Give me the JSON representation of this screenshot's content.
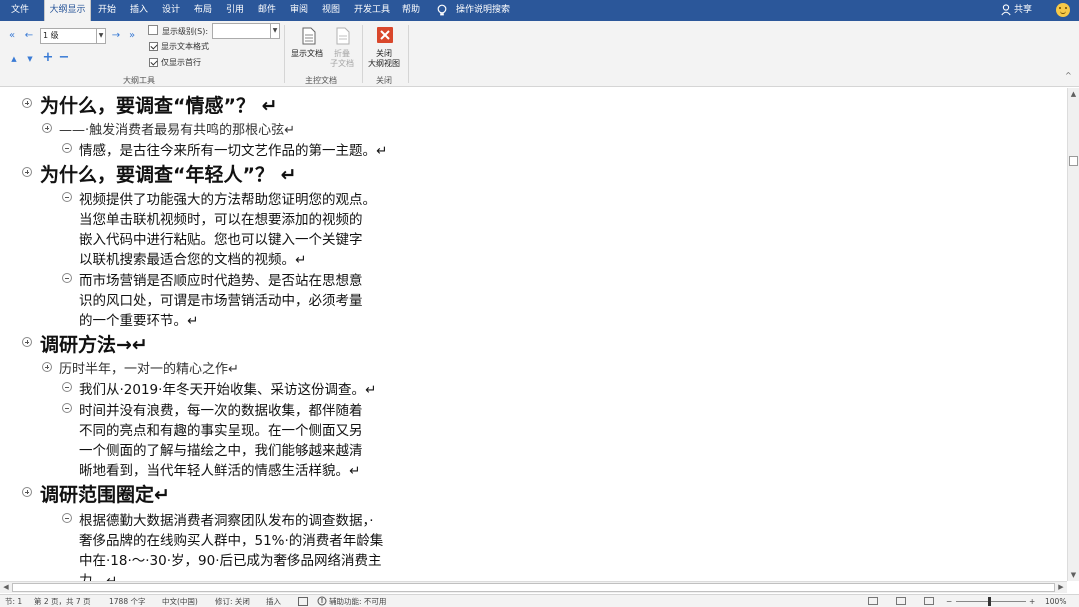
{
  "ribbon_tabs": {
    "file": "文件",
    "outline": "大纲显示",
    "home": "开始",
    "insert": "插入",
    "design": "设计",
    "layout": "布局",
    "references": "引用",
    "mailings": "邮件",
    "review": "审阅",
    "view": "视图",
    "developer": "开发工具",
    "help": "帮助",
    "tell_me": "操作说明搜索",
    "share": "共享"
  },
  "outline_tools": {
    "level_value": "1 级",
    "show_level_label": "显示级别(S):",
    "show_level_value": "",
    "show_text_formatting": "显示文本格式",
    "show_text_formatting_checked": true,
    "show_first_line_only": "仅显示首行",
    "show_first_line_only_checked": true,
    "group_label": "大纲工具"
  },
  "master_document": {
    "show_document": "显示文档",
    "collapse_line1": "折叠",
    "collapse_line2": "子文档",
    "group_label": "主控文档"
  },
  "close_group": {
    "close_line1": "关闭",
    "close_line2": "大纲视图",
    "group_label": "关闭"
  },
  "document": {
    "lines": [
      {
        "kind": "h1",
        "text": "为什么，要调查“情感”？ ↵"
      },
      {
        "kind": "sub",
        "text": "——·触发消费者最易有共鸣的那根心弦↵"
      },
      {
        "kind": "body",
        "text": "情感，是古往今来所有一切文艺作品的第一主题。↵"
      },
      {
        "kind": "h1",
        "text": "为什么，要调查“年轻人”？ ↵"
      },
      {
        "kind": "body",
        "text": "视频提供了功能强大的方法帮助您证明您的观点。"
      },
      {
        "kind": "body",
        "text": "当您单击联机视频时，可以在想要添加的视频的"
      },
      {
        "kind": "body",
        "text": "嵌入代码中进行粘贴。您也可以键入一个关键字"
      },
      {
        "kind": "body",
        "text": "以联机搜索最适合您的文档的视频。↵"
      },
      {
        "kind": "body",
        "text": "而市场营销是否顺应时代趋势、是否站在思想意"
      },
      {
        "kind": "body",
        "text": "识的风口处，可谓是市场营销活动中，必须考量"
      },
      {
        "kind": "body",
        "text": "的一个重要环节。↵"
      },
      {
        "kind": "h1",
        "text": "调研方法→↵"
      },
      {
        "kind": "sub",
        "text": "历时半年，一对一的精心之作↵"
      },
      {
        "kind": "body",
        "text": "我们从·2019·年冬天开始收集、采访这份调查。↵"
      },
      {
        "kind": "body",
        "text": "时间并没有浪费，每一次的数据收集，都伴随着"
      },
      {
        "kind": "body",
        "text": "不同的亮点和有趣的事实呈现。在一个侧面又另"
      },
      {
        "kind": "body",
        "text": "一个侧面的了解与描绘之中，我们能够越来越清"
      },
      {
        "kind": "body",
        "text": "晰地看到，当代年轻人鲜活的情感生活样貌。↵"
      },
      {
        "kind": "h1",
        "text": "调研范围圈定↵"
      },
      {
        "kind": "body",
        "text": "根据德勤大数据消费者洞察团队发布的调查数据，·"
      },
      {
        "kind": "body",
        "text": "奢侈品牌的在线购买人群中，51%·的消费者年龄集"
      },
      {
        "kind": "body",
        "text": "中在·18·～·30·岁，90·后已成为奢侈品网络消费主"
      },
      {
        "kind": "body",
        "text": "力。↵"
      }
    ]
  },
  "status_bar": {
    "section": "节: 1",
    "page": "第 2 页，共 7 页",
    "words": "1788 个字",
    "language": "中文(中国)",
    "track_changes": "修订: 关闭",
    "insert_mode": "插入",
    "accessibility": "辅助功能: 不可用",
    "zoom_minus": "−",
    "zoom_plus": "+",
    "zoom": "100%"
  },
  "colors": {
    "ribbon_blue": "#2b579a",
    "ribbon_bg": "#f3f3f3",
    "close_red": "#d9472b",
    "nav_arrow_blue": "#3a7bd5"
  }
}
